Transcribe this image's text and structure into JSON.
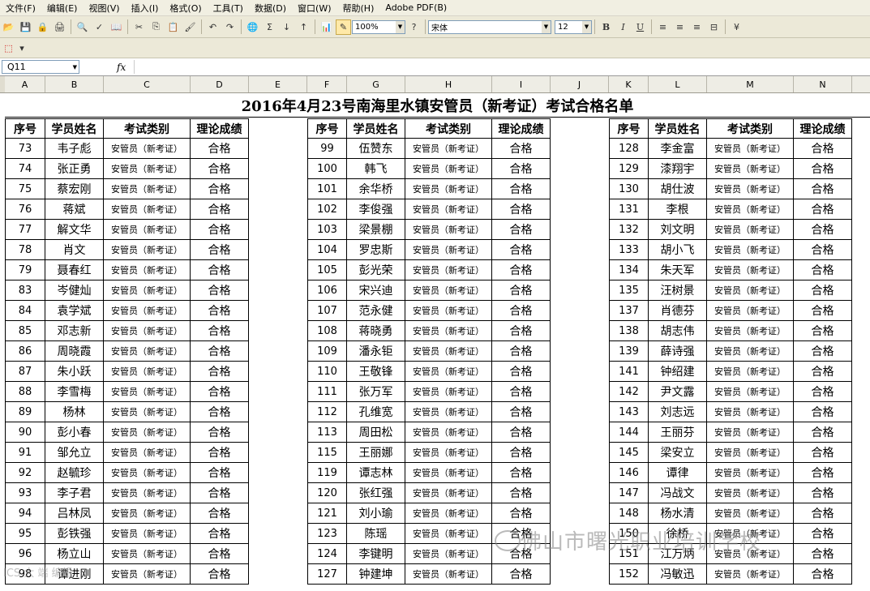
{
  "menu": [
    "文件(F)",
    "编辑(E)",
    "视图(V)",
    "插入(I)",
    "格式(O)",
    "工具(T)",
    "数据(D)",
    "窗口(W)",
    "帮助(H)",
    "Adobe PDF(B)"
  ],
  "toolbar": {
    "zoom": "100%",
    "font_name": "宋体",
    "font_size": "12",
    "bold": "B",
    "italic": "I",
    "underline": "U"
  },
  "formula_bar": {
    "name_box": "Q11",
    "fx": "fx",
    "content": ""
  },
  "columns": [
    "A",
    "B",
    "C",
    "D",
    "E",
    "F",
    "G",
    "H",
    "I",
    "J",
    "K",
    "L",
    "M",
    "N"
  ],
  "sheet": {
    "title": "2016年4月23号南海里水镇安管员（新考证）考试合格名单",
    "headers": [
      "序号",
      "学员姓名",
      "考试类别",
      "理论成绩"
    ],
    "exam_type": "安管员（新考证）",
    "pass_text": "合格",
    "blocks": [
      {
        "rows": [
          [
            "73",
            "韦子彪"
          ],
          [
            "74",
            "张正勇"
          ],
          [
            "75",
            "蔡宏刚"
          ],
          [
            "76",
            "蒋斌"
          ],
          [
            "77",
            "解文华"
          ],
          [
            "78",
            "肖文"
          ],
          [
            "79",
            "聂春红"
          ],
          [
            "83",
            "岑健灿"
          ],
          [
            "84",
            "袁学斌"
          ],
          [
            "85",
            "邓志新"
          ],
          [
            "86",
            "周晓霞"
          ],
          [
            "87",
            "朱小跃"
          ],
          [
            "88",
            "李雪梅"
          ],
          [
            "89",
            "杨林"
          ],
          [
            "90",
            "彭小春"
          ],
          [
            "91",
            "邹允立"
          ],
          [
            "92",
            "赵毓珍"
          ],
          [
            "93",
            "李子君"
          ],
          [
            "94",
            "吕林凤"
          ],
          [
            "95",
            "彭铁强"
          ],
          [
            "96",
            "杨立山"
          ],
          [
            "98",
            "谭进刚"
          ]
        ]
      },
      {
        "rows": [
          [
            "99",
            "伍赞东"
          ],
          [
            "100",
            "韩飞"
          ],
          [
            "101",
            "余华桥"
          ],
          [
            "102",
            "李俊强"
          ],
          [
            "103",
            "梁景棚"
          ],
          [
            "104",
            "罗忠斯"
          ],
          [
            "105",
            "彭光荣"
          ],
          [
            "106",
            "宋兴迪"
          ],
          [
            "107",
            "范永健"
          ],
          [
            "108",
            "蒋晓勇"
          ],
          [
            "109",
            "潘永钜"
          ],
          [
            "110",
            "王敬锋"
          ],
          [
            "111",
            "张万军"
          ],
          [
            "112",
            "孔维宽"
          ],
          [
            "113",
            "周田松"
          ],
          [
            "115",
            "王丽娜"
          ],
          [
            "119",
            "谭志林"
          ],
          [
            "120",
            "张红强"
          ],
          [
            "121",
            "刘小瑜"
          ],
          [
            "123",
            "陈瑶"
          ],
          [
            "124",
            "李键明"
          ],
          [
            "127",
            "钟建坤"
          ]
        ]
      },
      {
        "rows": [
          [
            "128",
            "李金富"
          ],
          [
            "129",
            "漆翔宇"
          ],
          [
            "130",
            "胡仕波"
          ],
          [
            "131",
            "李根"
          ],
          [
            "132",
            "刘文明"
          ],
          [
            "133",
            "胡小飞"
          ],
          [
            "134",
            "朱天军"
          ],
          [
            "135",
            "汪树景"
          ],
          [
            "137",
            "肖德芬"
          ],
          [
            "138",
            "胡志伟"
          ],
          [
            "139",
            "薛诗强"
          ],
          [
            "141",
            "钟绍建"
          ],
          [
            "142",
            "尹文露"
          ],
          [
            "143",
            "刘志远"
          ],
          [
            "144",
            "王丽芬"
          ],
          [
            "145",
            "梁安立"
          ],
          [
            "146",
            "谭律"
          ],
          [
            "147",
            "冯战文"
          ],
          [
            "148",
            "杨水清"
          ],
          [
            "150",
            "徐桥"
          ],
          [
            "151",
            "江万炳"
          ],
          [
            "152",
            "冯敏迅"
          ]
        ]
      }
    ]
  },
  "watermark": {
    "text": "佛山市曙光职业培训学校",
    "corner": "ICS 大 端 编辑"
  }
}
